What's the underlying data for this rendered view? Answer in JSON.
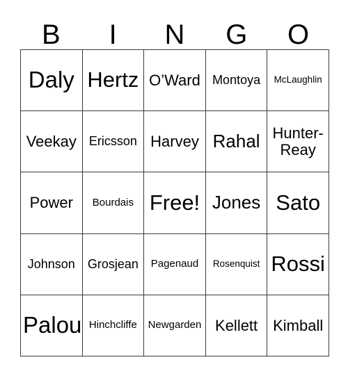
{
  "card": {
    "title": "BINGO",
    "header_letters": [
      "B",
      "I",
      "N",
      "G",
      "O"
    ],
    "free_space_label": "Free!",
    "colors": {
      "background": "#ffffff",
      "text": "#000000",
      "grid_line": "#3a3a3a"
    },
    "grid": {
      "columns": 5,
      "rows": 5,
      "cells": [
        [
          {
            "label": "Daly",
            "size": "xxl"
          },
          {
            "label": "Hertz",
            "size": "xl"
          },
          {
            "label": "O’Ward",
            "size": "md"
          },
          {
            "label": "Montoya",
            "size": "sm"
          },
          {
            "label": "McLaughlin",
            "size": "xxs"
          }
        ],
        [
          {
            "label": "Veekay",
            "size": "md"
          },
          {
            "label": "Ericsson",
            "size": "sm"
          },
          {
            "label": "Harvey",
            "size": "md"
          },
          {
            "label": "Rahal",
            "size": "lg"
          },
          {
            "label": "Hunter-Reay",
            "size": "md"
          }
        ],
        [
          {
            "label": "Power",
            "size": "md"
          },
          {
            "label": "Bourdais",
            "size": "xs"
          },
          {
            "label": "Free!",
            "size": "xl"
          },
          {
            "label": "Jones",
            "size": "lg"
          },
          {
            "label": "Sato",
            "size": "xl"
          }
        ],
        [
          {
            "label": "Johnson",
            "size": "sm"
          },
          {
            "label": "Grosjean",
            "size": "sm"
          },
          {
            "label": "Pagenaud",
            "size": "xs"
          },
          {
            "label": "Rosenquist",
            "size": "xxs"
          },
          {
            "label": "Rossi",
            "size": "xl"
          }
        ],
        [
          {
            "label": "Palou",
            "size": "xxl"
          },
          {
            "label": "Hinchcliffe",
            "size": "xs"
          },
          {
            "label": "Newgarden",
            "size": "xs"
          },
          {
            "label": "Kellett",
            "size": "md"
          },
          {
            "label": "Kimball",
            "size": "md"
          }
        ]
      ]
    }
  }
}
